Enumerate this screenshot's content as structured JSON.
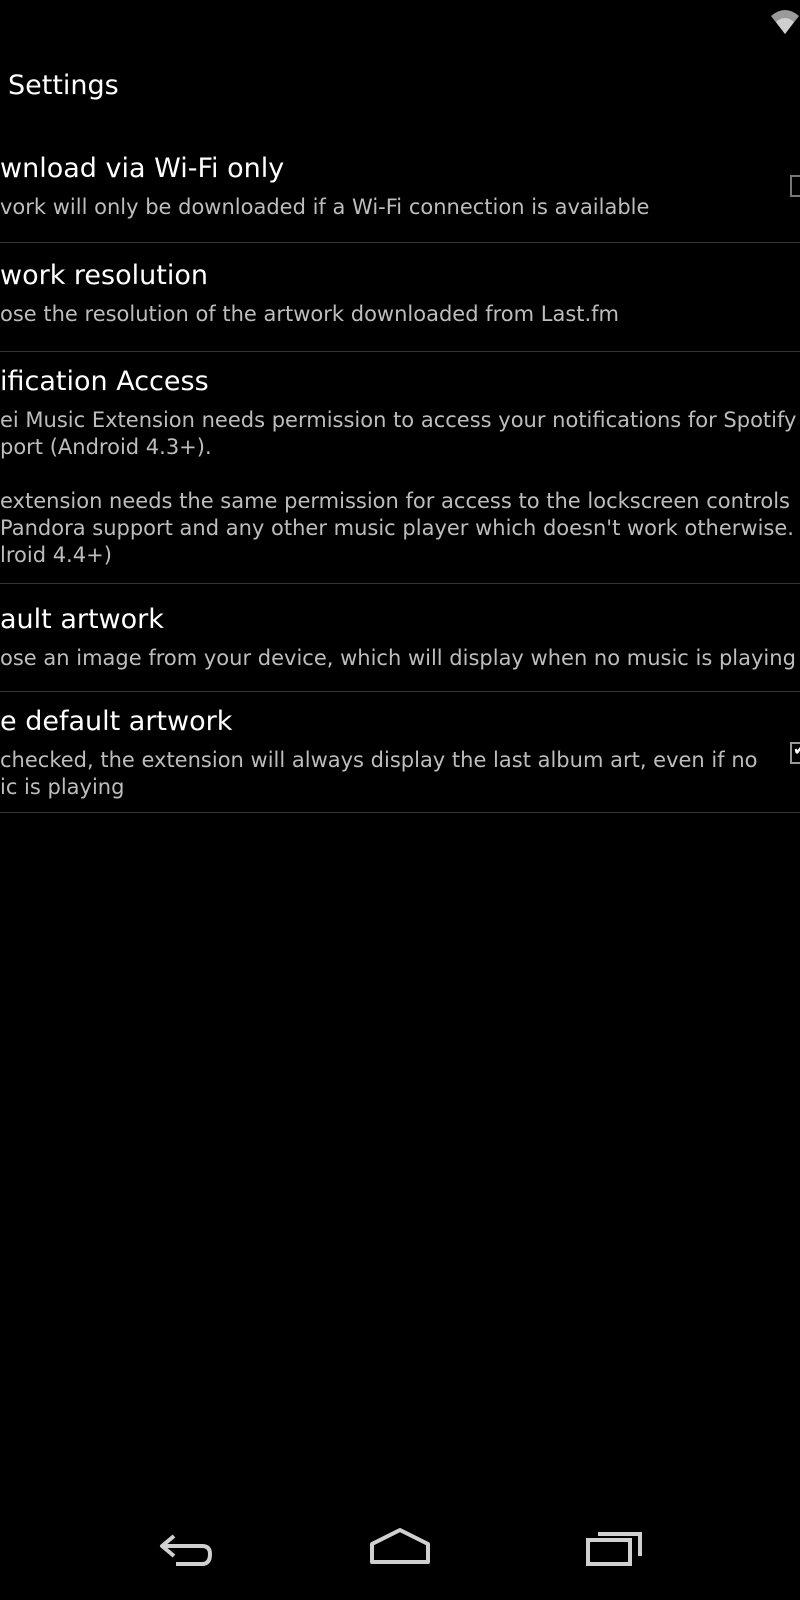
{
  "action_bar": {
    "title": "Settings"
  },
  "preferences": [
    {
      "title": "wnload via Wi-Fi only",
      "summary": "vork will only be downloaded if a Wi-Fi connection is available",
      "checkbox": true,
      "checked": false
    },
    {
      "title": "work resolution",
      "summary": "ose the resolution of the artwork downloaded from Last.fm",
      "checkbox": false
    },
    {
      "title": "ification Access",
      "summary": "ei Music Extension needs permission to access your notifications for Spotify\nport (Android 4.3+).\n\nextension needs the same permission for access to the lockscreen controls\nPandora support and any other music player which doesn't work otherwise.\nlroid 4.4+)",
      "checkbox": false
    },
    {
      "title": "ault artwork",
      "summary": "ose an image from your device, which will display when no music is playing",
      "checkbox": false
    },
    {
      "title": "e default artwork",
      "summary": "checked, the extension will always display the last album art, even if no\nic is playing",
      "checkbox": true,
      "checked": true
    }
  ],
  "status_bar": {
    "icons": [
      "wifi-icon"
    ]
  },
  "nav_bar": {
    "icons": [
      "back-icon",
      "home-icon",
      "recent-apps-icon"
    ]
  },
  "colors": {
    "background": "#000000",
    "title_text": "#ffffff",
    "summary_text": "#bdbdbd",
    "divider": "#333333"
  }
}
